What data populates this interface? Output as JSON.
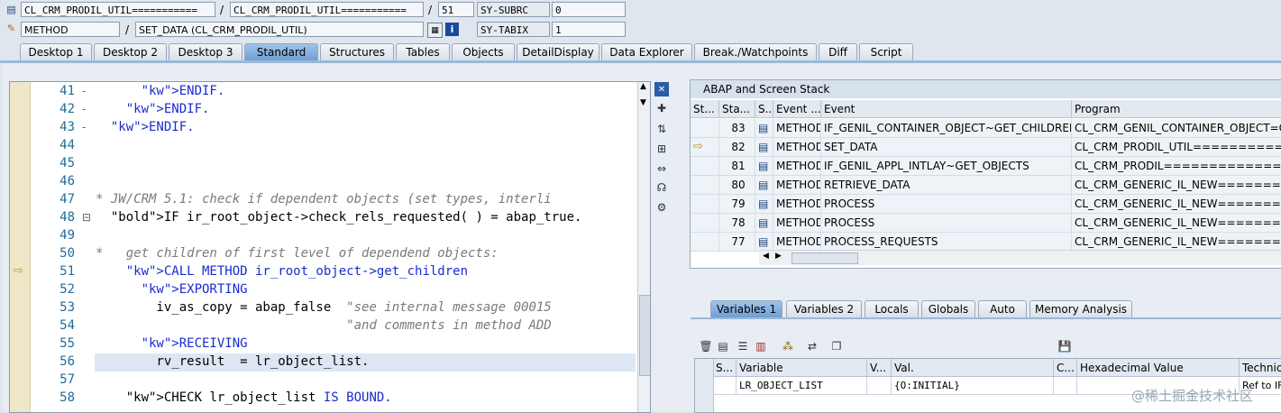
{
  "header": {
    "row1": {
      "class_a": "CL_CRM_PRODIL_UTIL===========",
      "class_b": "CL_CRM_PRODIL_UTIL===========",
      "line": "51",
      "sysvar_label": "SY-SUBRC",
      "sysvar_value": "0"
    },
    "row2": {
      "type": "METHOD",
      "name": "SET_DATA (CL_CRM_PRODIL_UTIL)",
      "sysvar_label": "SY-TABIX",
      "sysvar_value": "1"
    },
    "slash": "/"
  },
  "tabs": [
    "Desktop 1",
    "Desktop 2",
    "Desktop 3",
    "Standard",
    "Structures",
    "Tables",
    "Objects",
    "DetailDisplay",
    "Data Explorer",
    "Break./Watchpoints",
    "Diff",
    "Script"
  ],
  "active_tab": "Standard",
  "editor": {
    "lines": [
      {
        "num": "41",
        "marker": "-",
        "text": "      ENDIF."
      },
      {
        "num": "42",
        "marker": "-",
        "text": "    ENDIF."
      },
      {
        "num": "43",
        "marker": "-",
        "text": "  ENDIF."
      },
      {
        "num": "44",
        "marker": "",
        "text": ""
      },
      {
        "num": "45",
        "marker": "",
        "text": ""
      },
      {
        "num": "46",
        "marker": "",
        "text": ""
      },
      {
        "num": "47",
        "marker": "",
        "text": "* JW/CRM 5.1: check if dependent objects (set types, interli"
      },
      {
        "num": "48",
        "marker": "⊟",
        "text": "  IF ir_root_object->check_rels_requested( ) = abap_true."
      },
      {
        "num": "49",
        "marker": "",
        "text": ""
      },
      {
        "num": "50",
        "marker": "",
        "text": "*   get children of first level of dependend objects:"
      },
      {
        "num": "51",
        "marker": "",
        "text": "    CALL METHOD ir_root_object->get_children"
      },
      {
        "num": "52",
        "marker": "",
        "text": "      EXPORTING"
      },
      {
        "num": "53",
        "marker": "",
        "text": "        iv_as_copy = abap_false  \"see internal message 00015"
      },
      {
        "num": "54",
        "marker": "",
        "text": "                                 \"and comments in method ADD"
      },
      {
        "num": "55",
        "marker": "",
        "text": "      RECEIVING"
      },
      {
        "num": "56",
        "marker": "",
        "text": "        rv_result  = lr_object_list."
      },
      {
        "num": "57",
        "marker": "",
        "text": ""
      },
      {
        "num": "58",
        "marker": "",
        "text": "    CHECK lr_object_list IS BOUND."
      }
    ]
  },
  "stack": {
    "title": "ABAP and Screen Stack",
    "columns": [
      "St...",
      "Sta...",
      "S...",
      "Event ...",
      "Event",
      "Program"
    ],
    "rows": [
      {
        "st": "",
        "level": "83",
        "type": "METHOD",
        "event": "IF_GENIL_CONTAINER_OBJECT~GET_CHILDREN",
        "program": "CL_CRM_GENIL_CONTAINER_OBJECT=CP"
      },
      {
        "st": "⇨",
        "level": "82",
        "type": "METHOD",
        "event": "SET_DATA",
        "program": "CL_CRM_PRODIL_UTIL=============="
      },
      {
        "st": "",
        "level": "81",
        "type": "METHOD",
        "event": "IF_GENIL_APPL_INTLAY~GET_OBJECTS",
        "program": "CL_CRM_PRODIL=================="
      },
      {
        "st": "",
        "level": "80",
        "type": "METHOD",
        "event": "RETRIEVE_DATA",
        "program": "CL_CRM_GENERIC_IL_NEW=========="
      },
      {
        "st": "",
        "level": "79",
        "type": "METHOD",
        "event": "PROCESS",
        "program": "CL_CRM_GENERIC_IL_NEW=========="
      },
      {
        "st": "",
        "level": "78",
        "type": "METHOD",
        "event": "PROCESS",
        "program": "CL_CRM_GENERIC_IL_NEW=========="
      },
      {
        "st": "",
        "level": "77",
        "type": "METHOD",
        "event": "PROCESS_REQUESTS",
        "program": "CL_CRM_GENERIC_IL_NEW=========="
      }
    ]
  },
  "var_tabs": [
    "Variables 1",
    "Variables 2",
    "Locals",
    "Globals",
    "Auto",
    "Memory Analysis"
  ],
  "active_var_tab": "Variables 1",
  "vars": {
    "columns": [
      "S...",
      "Variable",
      "V...",
      "Val.",
      "C...",
      "Hexadecimal Value",
      "Technica"
    ],
    "rows": [
      {
        "variable": "LR_OBJECT_LIST",
        "value": "{O:INITIAL}",
        "technical": "Ref to IF"
      }
    ]
  },
  "watermark": "@稀土掘金技术社区"
}
